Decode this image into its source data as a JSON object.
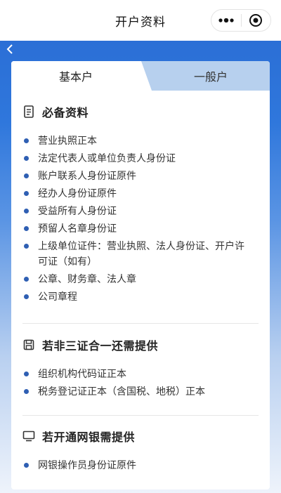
{
  "nav": {
    "title": "开户资料"
  },
  "tabs": [
    {
      "label": "基本户",
      "active": true
    },
    {
      "label": "一般户",
      "active": false
    }
  ],
  "sections": [
    {
      "icon": "document-icon",
      "heading": "必备资料",
      "items": [
        "营业执照正本",
        "法定代表人或单位负责人身份证",
        "账户联系人身份证原件",
        "经办人身份证原件",
        "受益所有人身份证",
        "预留人名章身份证",
        "上级单位证件：营业执照、法人身份证、开户许可证（如有）",
        "公章、财务章、法人章",
        "公司章程"
      ]
    },
    {
      "icon": "save-icon",
      "heading": "若非三证合一还需提供",
      "items": [
        "组织机构代码证正本",
        "税务登记证正本（含国税、地税）正本"
      ]
    },
    {
      "icon": "monitor-icon",
      "heading": "若开通网银需提供",
      "items": [
        "网银操作员身份证原件"
      ]
    }
  ],
  "colors": {
    "primary": "#2b6fd6",
    "bullet": "#2f5fb3",
    "tab_inactive": "#b7d0ee"
  }
}
